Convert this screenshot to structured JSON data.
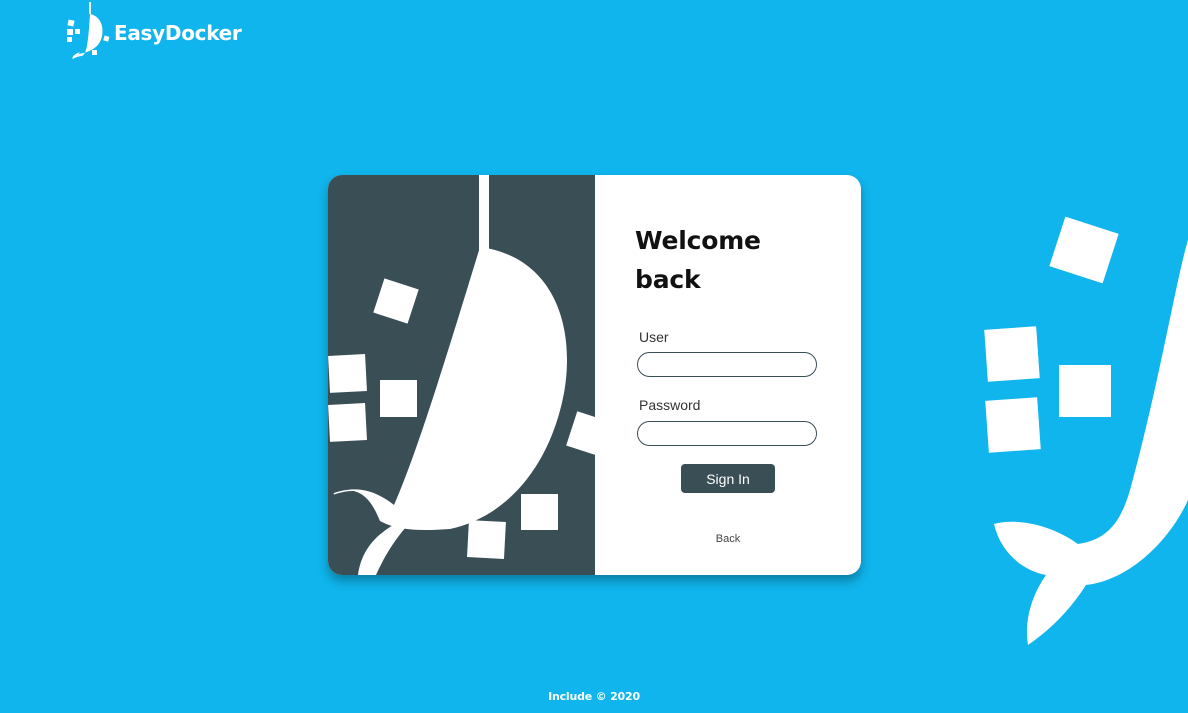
{
  "brand": {
    "name": "EasyDocker",
    "logo_icon": "whale-broom-icon"
  },
  "login": {
    "heading": "Welcome back",
    "user_label": "User",
    "user_value": "",
    "password_label": "Password",
    "password_value": "",
    "submit_label": "Sign In",
    "back_label": "Back",
    "illustration_icon": "whale-broom-illustration"
  },
  "footer": {
    "text": "Include © 2020"
  },
  "colors": {
    "background": "#0fb5ec",
    "panel_dark": "#3a4e56",
    "card": "#ffffff",
    "text": "#111111"
  }
}
